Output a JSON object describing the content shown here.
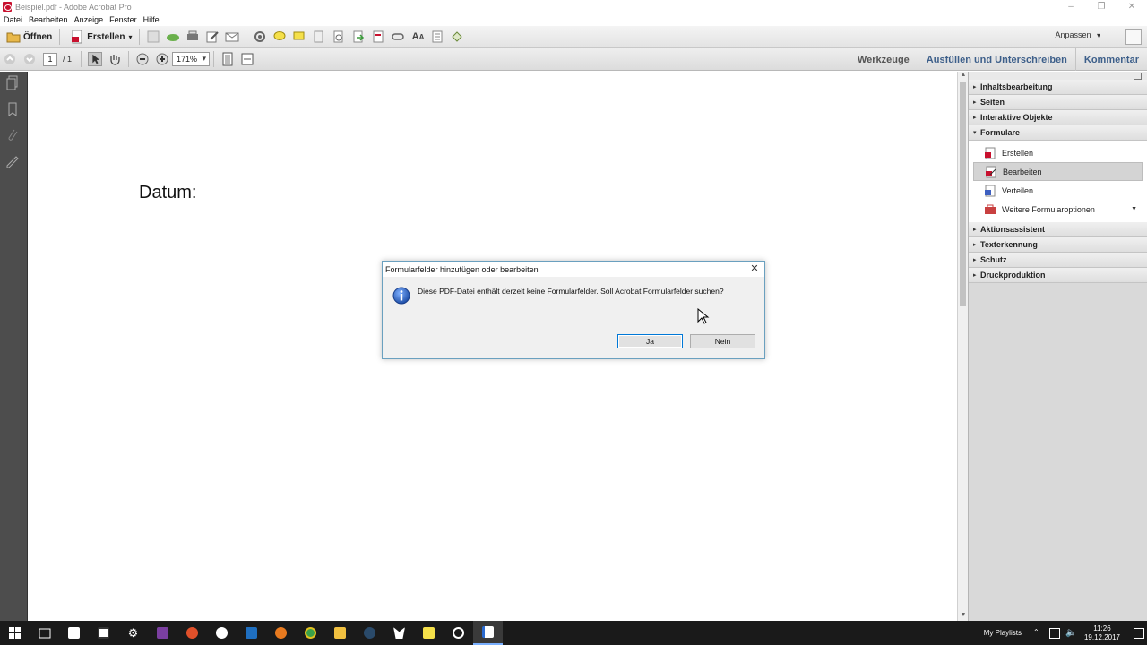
{
  "window": {
    "title": "Beispiel.pdf - Adobe Acrobat Pro"
  },
  "menu": {
    "items": [
      "Datei",
      "Bearbeiten",
      "Anzeige",
      "Fenster",
      "Hilfe"
    ]
  },
  "toolbar": {
    "open_label": "Öffnen",
    "create_label": "Erstellen",
    "customize_label": "Anpassen"
  },
  "navbar": {
    "page_current": "1",
    "page_total": "/ 1",
    "zoom": "171%"
  },
  "tabs": {
    "tools": "Werkzeuge",
    "fill_sign": "Ausfüllen und Unterschreiben",
    "comment": "Kommentar"
  },
  "document": {
    "text": "Datum:"
  },
  "taskpane": {
    "sections_top": [
      "Inhaltsbearbeitung",
      "Seiten",
      "Interaktive Objekte"
    ],
    "open_section": "Formulare",
    "open_items": [
      "Erstellen",
      "Bearbeiten",
      "Verteilen",
      "Weitere Formularoptionen"
    ],
    "sections_bottom": [
      "Aktionsassistent",
      "Texterkennung",
      "Schutz",
      "Druckproduktion"
    ]
  },
  "dialog": {
    "title": "Formularfelder hinzufügen oder bearbeiten",
    "message": "Diese PDF-Datei enthält derzeit keine Formularfelder. Soll Acrobat Formularfelder suchen?",
    "yes": "Ja",
    "no": "Nein"
  },
  "taskbar": {
    "playlists": "My Playlists",
    "time": "11:26",
    "date": "19.12.2017"
  },
  "colors": {
    "accent_blue": "#3d5f8a",
    "nav_dark": "#4d4d4d",
    "taskbar": "#1a1a1a",
    "info_blue": "#1f5fbf"
  }
}
